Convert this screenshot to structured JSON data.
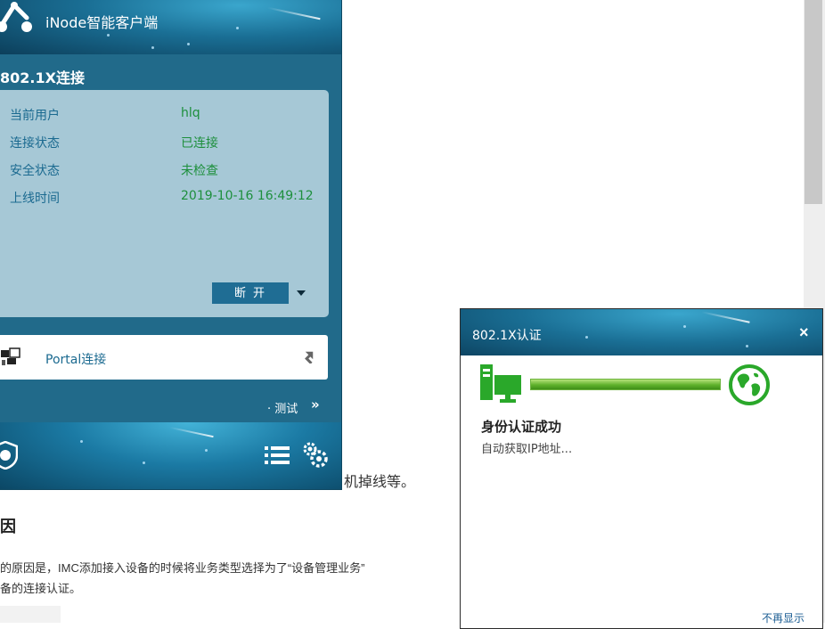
{
  "document": {
    "text_fragment": "机掉线等。",
    "heading": "因",
    "paragraph_line1": "的原因是，IMC添加接入设备的时候将业务类型选择为了“设备管理业务”",
    "paragraph_line2": "备的连接认证。"
  },
  "inode": {
    "title": "iNode智能客户端",
    "section_title": "802.1X连接",
    "info_rows": [
      {
        "label": "当前用户",
        "value": "hlq"
      },
      {
        "label": "连接状态",
        "value": "已连接"
      },
      {
        "label": "安全状态",
        "value": "未检查"
      },
      {
        "label": "上线时间",
        "value": "2019-10-16 16:49:12"
      }
    ],
    "disconnect_label": "断开",
    "portal_label": "Portal连接",
    "test_label": "· 测试",
    "test_chevron": "»"
  },
  "dialog": {
    "title": "802.1X认证",
    "close_label": "×",
    "progress_fraction": 1.0,
    "auth_title": "身份认证成功",
    "auth_status": "自动获取IP地址...",
    "hide_link": "不再显示"
  },
  "colors": {
    "brand_blue": "#216a8a",
    "value_green": "#1d8f3c",
    "label_blue": "#1b6a90",
    "progress_green": "#5fb12c"
  }
}
